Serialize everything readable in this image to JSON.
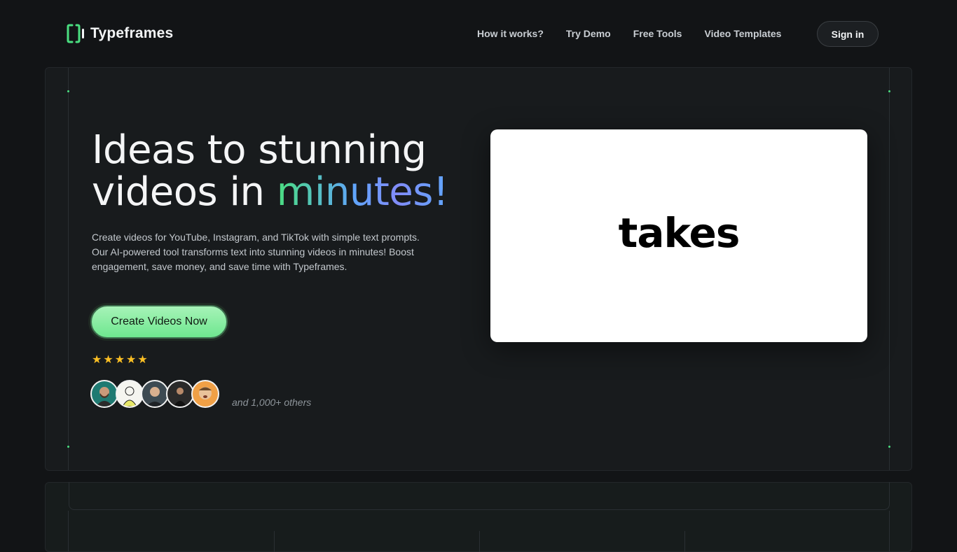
{
  "brand": {
    "name": "Typeframes"
  },
  "nav": {
    "links": [
      "How it works?",
      "Try Demo",
      "Free Tools",
      "Video Templates"
    ],
    "signin_label": "Sign in"
  },
  "hero": {
    "headline_part1": "Ideas to stunning videos in ",
    "headline_highlight": "minutes!",
    "description": "Create videos for YouTube, Instagram, and TikTok with simple text prompts. Our AI-powered tool transforms text into stunning videos in minutes! Boost engagement, save money, and save time with Typeframes.",
    "cta_label": "Create Videos Now",
    "rating_stars": 5,
    "social_proof": "and 1,000+ others",
    "video_preview_word": "takes"
  },
  "colors": {
    "accent_green": "#4ade80",
    "accent_blue": "#60a5fa",
    "accent_indigo": "#818cf8",
    "star": "#fbbf24",
    "background": "#121416"
  },
  "icons": [
    "logo-bracket-icon",
    "star-icon"
  ]
}
